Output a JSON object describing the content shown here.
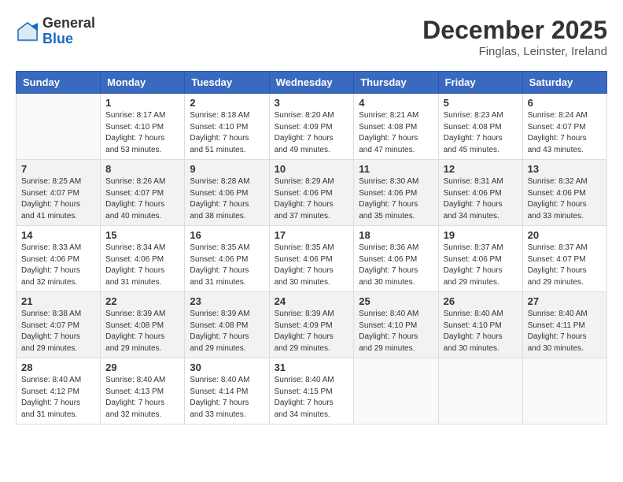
{
  "header": {
    "logo_general": "General",
    "logo_blue": "Blue",
    "month_title": "December 2025",
    "location": "Finglas, Leinster, Ireland"
  },
  "days_of_week": [
    "Sunday",
    "Monday",
    "Tuesday",
    "Wednesday",
    "Thursday",
    "Friday",
    "Saturday"
  ],
  "weeks": [
    [
      {
        "day": "",
        "info": ""
      },
      {
        "day": "1",
        "info": "Sunrise: 8:17 AM\nSunset: 4:10 PM\nDaylight: 7 hours\nand 53 minutes."
      },
      {
        "day": "2",
        "info": "Sunrise: 8:18 AM\nSunset: 4:10 PM\nDaylight: 7 hours\nand 51 minutes."
      },
      {
        "day": "3",
        "info": "Sunrise: 8:20 AM\nSunset: 4:09 PM\nDaylight: 7 hours\nand 49 minutes."
      },
      {
        "day": "4",
        "info": "Sunrise: 8:21 AM\nSunset: 4:08 PM\nDaylight: 7 hours\nand 47 minutes."
      },
      {
        "day": "5",
        "info": "Sunrise: 8:23 AM\nSunset: 4:08 PM\nDaylight: 7 hours\nand 45 minutes."
      },
      {
        "day": "6",
        "info": "Sunrise: 8:24 AM\nSunset: 4:07 PM\nDaylight: 7 hours\nand 43 minutes."
      }
    ],
    [
      {
        "day": "7",
        "info": "Sunrise: 8:25 AM\nSunset: 4:07 PM\nDaylight: 7 hours\nand 41 minutes."
      },
      {
        "day": "8",
        "info": "Sunrise: 8:26 AM\nSunset: 4:07 PM\nDaylight: 7 hours\nand 40 minutes."
      },
      {
        "day": "9",
        "info": "Sunrise: 8:28 AM\nSunset: 4:06 PM\nDaylight: 7 hours\nand 38 minutes."
      },
      {
        "day": "10",
        "info": "Sunrise: 8:29 AM\nSunset: 4:06 PM\nDaylight: 7 hours\nand 37 minutes."
      },
      {
        "day": "11",
        "info": "Sunrise: 8:30 AM\nSunset: 4:06 PM\nDaylight: 7 hours\nand 35 minutes."
      },
      {
        "day": "12",
        "info": "Sunrise: 8:31 AM\nSunset: 4:06 PM\nDaylight: 7 hours\nand 34 minutes."
      },
      {
        "day": "13",
        "info": "Sunrise: 8:32 AM\nSunset: 4:06 PM\nDaylight: 7 hours\nand 33 minutes."
      }
    ],
    [
      {
        "day": "14",
        "info": "Sunrise: 8:33 AM\nSunset: 4:06 PM\nDaylight: 7 hours\nand 32 minutes."
      },
      {
        "day": "15",
        "info": "Sunrise: 8:34 AM\nSunset: 4:06 PM\nDaylight: 7 hours\nand 31 minutes."
      },
      {
        "day": "16",
        "info": "Sunrise: 8:35 AM\nSunset: 4:06 PM\nDaylight: 7 hours\nand 31 minutes."
      },
      {
        "day": "17",
        "info": "Sunrise: 8:35 AM\nSunset: 4:06 PM\nDaylight: 7 hours\nand 30 minutes."
      },
      {
        "day": "18",
        "info": "Sunrise: 8:36 AM\nSunset: 4:06 PM\nDaylight: 7 hours\nand 30 minutes."
      },
      {
        "day": "19",
        "info": "Sunrise: 8:37 AM\nSunset: 4:06 PM\nDaylight: 7 hours\nand 29 minutes."
      },
      {
        "day": "20",
        "info": "Sunrise: 8:37 AM\nSunset: 4:07 PM\nDaylight: 7 hours\nand 29 minutes."
      }
    ],
    [
      {
        "day": "21",
        "info": "Sunrise: 8:38 AM\nSunset: 4:07 PM\nDaylight: 7 hours\nand 29 minutes."
      },
      {
        "day": "22",
        "info": "Sunrise: 8:39 AM\nSunset: 4:08 PM\nDaylight: 7 hours\nand 29 minutes."
      },
      {
        "day": "23",
        "info": "Sunrise: 8:39 AM\nSunset: 4:08 PM\nDaylight: 7 hours\nand 29 minutes."
      },
      {
        "day": "24",
        "info": "Sunrise: 8:39 AM\nSunset: 4:09 PM\nDaylight: 7 hours\nand 29 minutes."
      },
      {
        "day": "25",
        "info": "Sunrise: 8:40 AM\nSunset: 4:10 PM\nDaylight: 7 hours\nand 29 minutes."
      },
      {
        "day": "26",
        "info": "Sunrise: 8:40 AM\nSunset: 4:10 PM\nDaylight: 7 hours\nand 30 minutes."
      },
      {
        "day": "27",
        "info": "Sunrise: 8:40 AM\nSunset: 4:11 PM\nDaylight: 7 hours\nand 30 minutes."
      }
    ],
    [
      {
        "day": "28",
        "info": "Sunrise: 8:40 AM\nSunset: 4:12 PM\nDaylight: 7 hours\nand 31 minutes."
      },
      {
        "day": "29",
        "info": "Sunrise: 8:40 AM\nSunset: 4:13 PM\nDaylight: 7 hours\nand 32 minutes."
      },
      {
        "day": "30",
        "info": "Sunrise: 8:40 AM\nSunset: 4:14 PM\nDaylight: 7 hours\nand 33 minutes."
      },
      {
        "day": "31",
        "info": "Sunrise: 8:40 AM\nSunset: 4:15 PM\nDaylight: 7 hours\nand 34 minutes."
      },
      {
        "day": "",
        "info": ""
      },
      {
        "day": "",
        "info": ""
      },
      {
        "day": "",
        "info": ""
      }
    ]
  ]
}
